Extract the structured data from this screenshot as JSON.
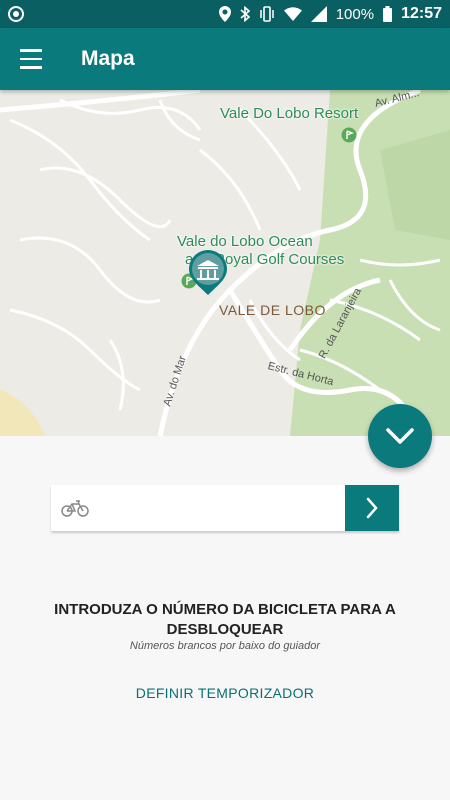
{
  "status_bar": {
    "battery": "100%",
    "time": "12:57"
  },
  "app_bar": {
    "title": "Mapa"
  },
  "map": {
    "places": {
      "resort": "Vale Do Lobo Resort",
      "golf_line1": "Vale do Lobo Ocean",
      "golf_line2": "and Royal Golf Courses",
      "town": "VALE DE LOBO"
    },
    "streets": {
      "av_mar": "Av. do Mar",
      "estr_horta": "Estr. da Horta",
      "r_laranjeira": "R. da Laranjeira",
      "av_top": "Av. Alm..."
    }
  },
  "unlock": {
    "input_value": "",
    "instruction": "INTRODUZA O NÚMERO DA BICICLETA PARA A DESBLOQUEAR",
    "hint": "Números brancos por baixo do guiador",
    "timer_link": "DEFINIR TEMPORIZADOR"
  },
  "colors": {
    "primary": "#0a7a7d",
    "status_bar": "#0a5f62",
    "map_green": "#c8dfb3"
  }
}
